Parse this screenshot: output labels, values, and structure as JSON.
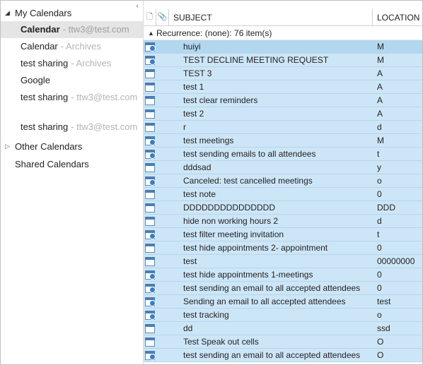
{
  "sidebar": {
    "groups": [
      {
        "key": "my",
        "label": "My Calendars",
        "expanded": true,
        "items": [
          {
            "name": "Calendar",
            "suffix": "- ttw3@test.com",
            "selected": true,
            "bold": true
          },
          {
            "name": "Calendar",
            "suffix": "- Archives"
          },
          {
            "name": "test sharing",
            "suffix": "- Archives"
          },
          {
            "name": "Google",
            "suffix": ""
          },
          {
            "name": "test sharing",
            "suffix": "- ttw3@test.com"
          },
          {
            "spacer": true
          },
          {
            "name": "test sharing",
            "suffix": "- ttw3@test.com"
          }
        ]
      },
      {
        "key": "other",
        "label": "Other Calendars",
        "expanded": false,
        "items": []
      },
      {
        "key": "shared",
        "label": "Shared Calendars",
        "expanded": null,
        "items": []
      }
    ]
  },
  "columns": {
    "icon_header": "🗋",
    "attach_header": "📎",
    "subject": "SUBJECT",
    "location": "LOCATION"
  },
  "group_row": {
    "label": "Recurrence: (none): 76 item(s)"
  },
  "rows": [
    {
      "type": "meeting",
      "subject": "huiyi",
      "location": "M",
      "selected": true
    },
    {
      "type": "meeting",
      "subject": "TEST DECLINE MEETING REQUEST",
      "location": "M"
    },
    {
      "type": "appt",
      "subject": "TEST 3",
      "location": "A"
    },
    {
      "type": "appt",
      "subject": "test 1",
      "location": "A"
    },
    {
      "type": "appt",
      "subject": "test clear reminders",
      "location": "A"
    },
    {
      "type": "appt",
      "subject": "test 2",
      "location": "A"
    },
    {
      "type": "appt",
      "subject": "r",
      "location": "d"
    },
    {
      "type": "meeting",
      "subject": "test meetings",
      "location": "M"
    },
    {
      "type": "meeting",
      "subject": "test sending emails to all attendees",
      "location": "t"
    },
    {
      "type": "appt",
      "subject": "dddsad",
      "location": "y"
    },
    {
      "type": "meeting",
      "subject": "Canceled: test cancelled meetings",
      "location": "o"
    },
    {
      "type": "appt",
      "subject": "test note",
      "location": "0"
    },
    {
      "type": "appt",
      "subject": "DDDDDDDDDDDDDDD",
      "location": "DDD"
    },
    {
      "type": "appt",
      "subject": "hide non working hours 2",
      "location": "d"
    },
    {
      "type": "meeting",
      "subject": "test filter meeting invitation",
      "location": "t"
    },
    {
      "type": "appt",
      "subject": "test hide appointments 2- appointment",
      "location": "0"
    },
    {
      "type": "appt",
      "subject": "test",
      "location": "00000000"
    },
    {
      "type": "meeting",
      "subject": "test hide appointments 1-meetings",
      "location": "0"
    },
    {
      "type": "meeting",
      "subject": "test sending an email to all accepted attendees",
      "location": "0"
    },
    {
      "type": "meeting",
      "subject": "Sending an email to all accepted attendees",
      "location": "test"
    },
    {
      "type": "meeting",
      "subject": "test tracking",
      "location": "o"
    },
    {
      "type": "appt",
      "subject": "dd",
      "location": "ssd"
    },
    {
      "type": "appt",
      "subject": "Test Speak out cells",
      "location": "O"
    },
    {
      "type": "meeting",
      "subject": "test sending an email to all accepted attendees",
      "location": "O"
    }
  ]
}
